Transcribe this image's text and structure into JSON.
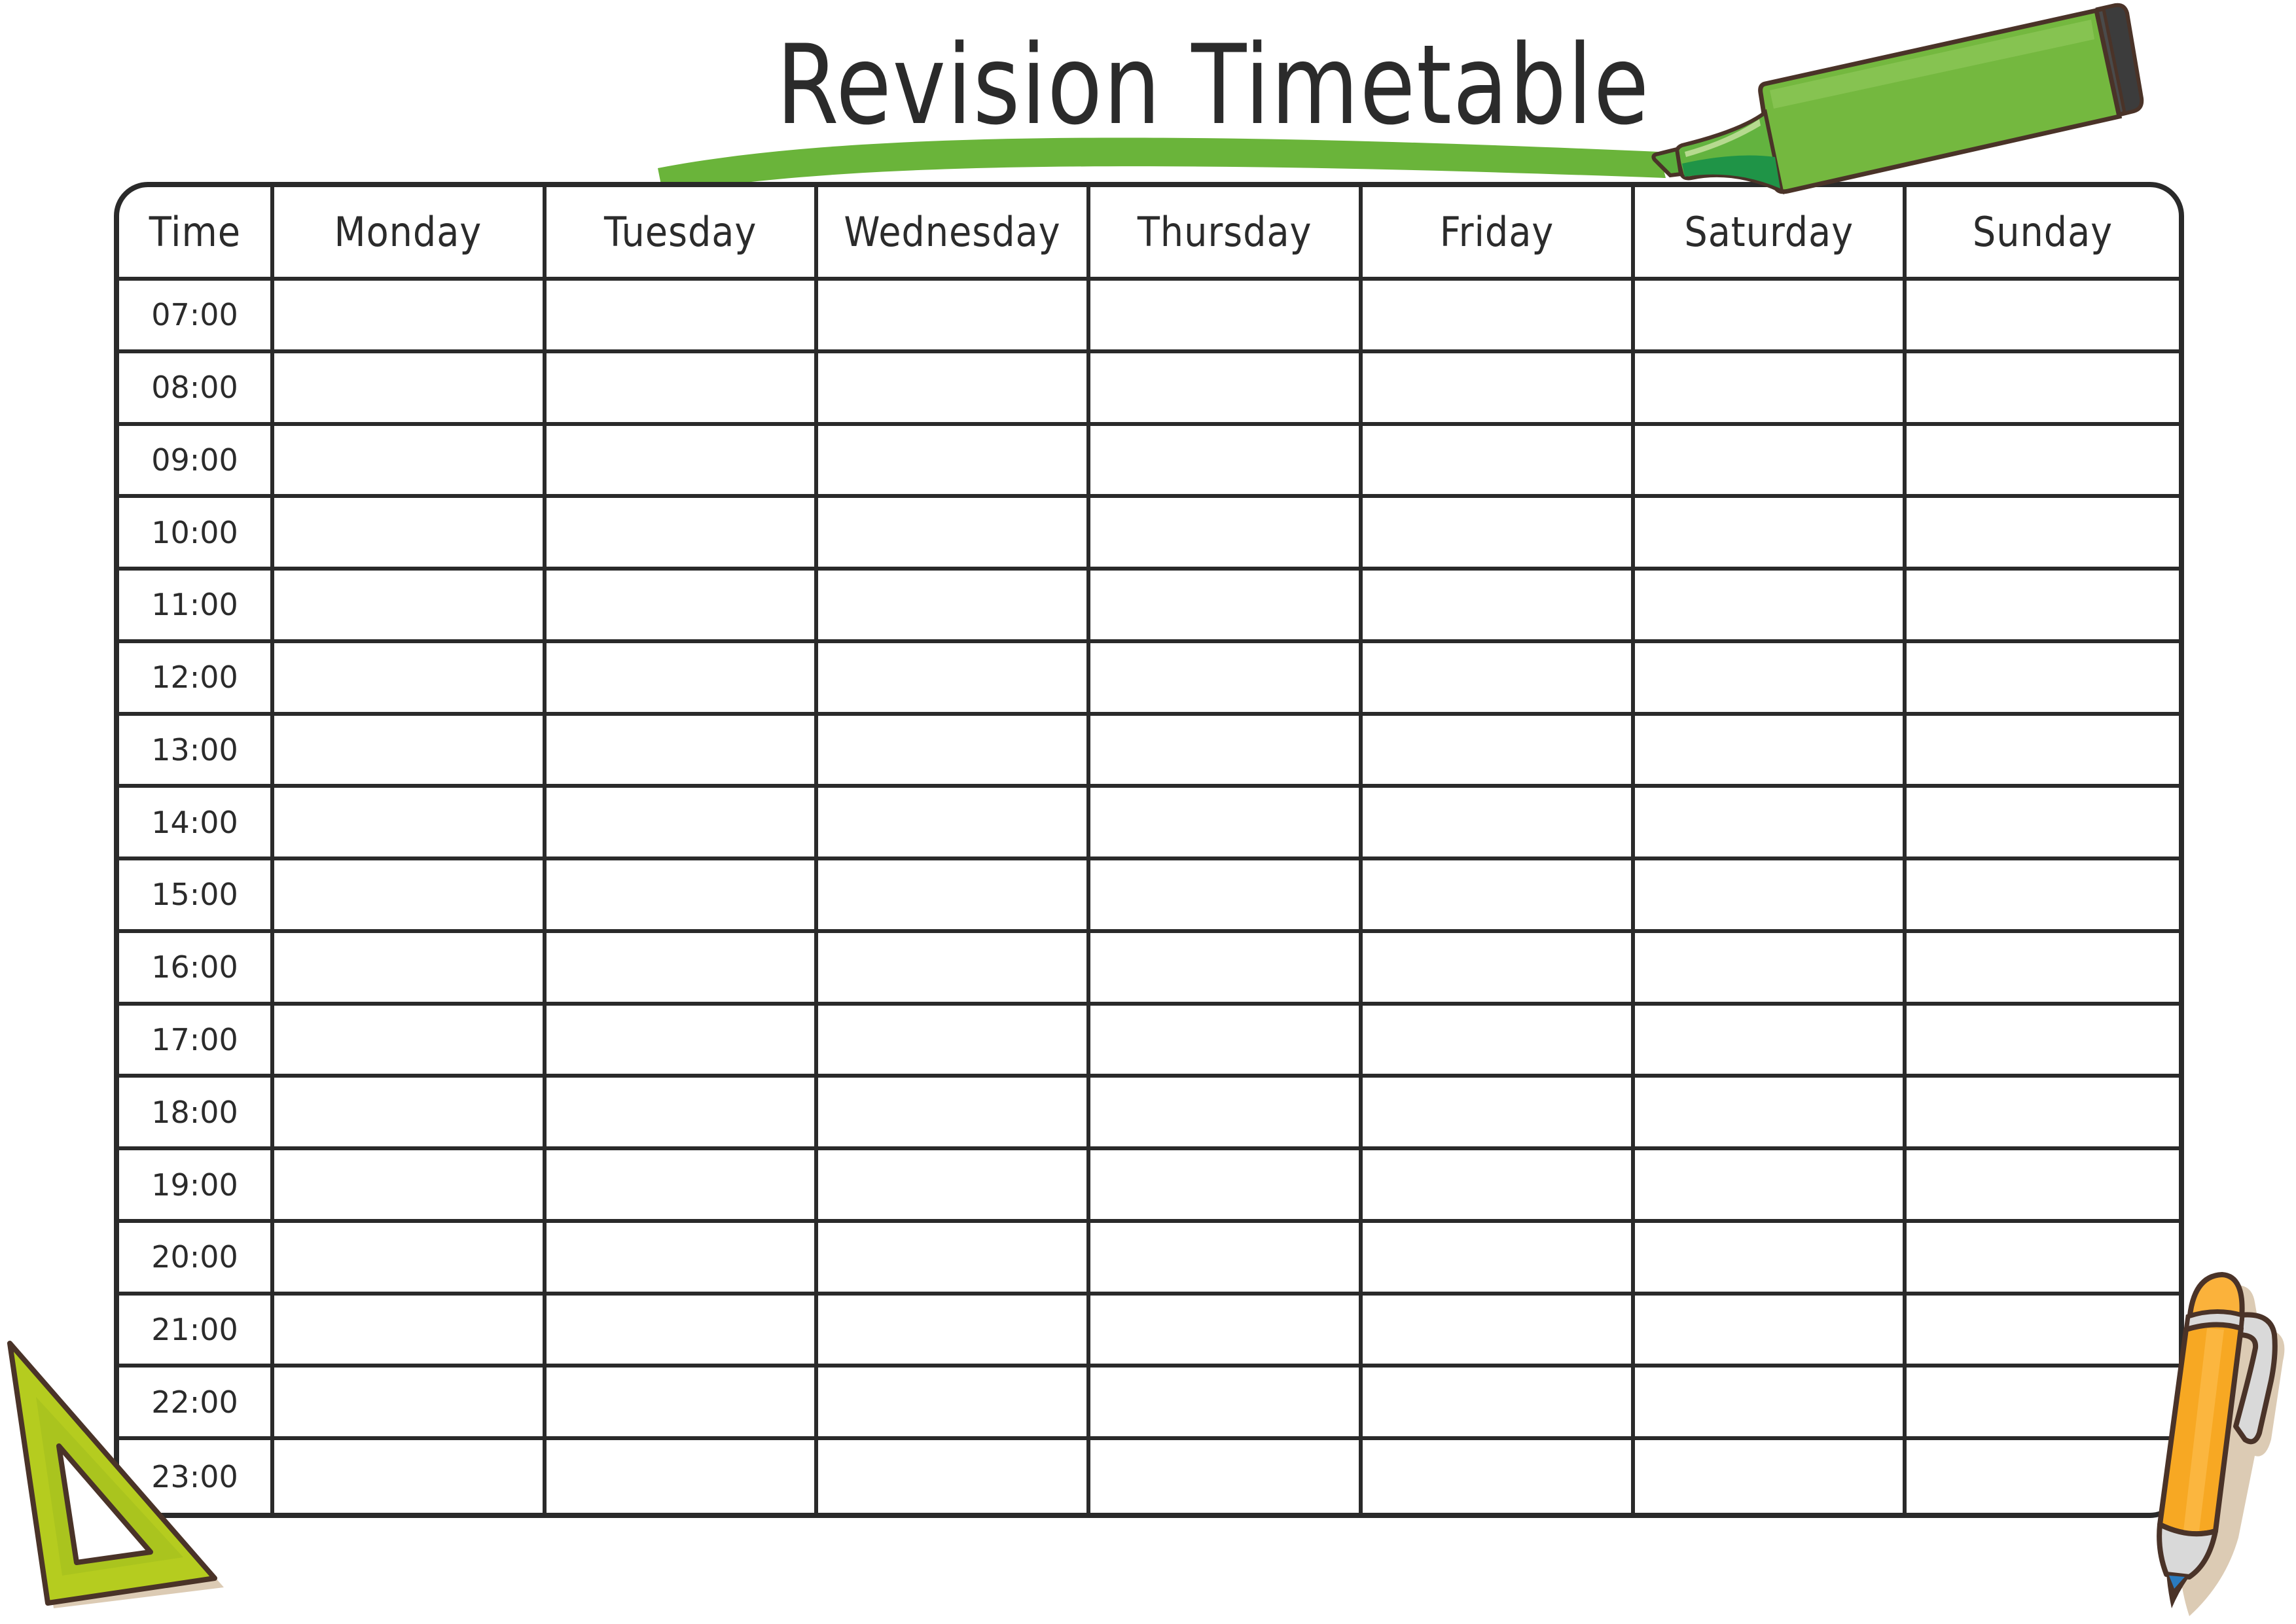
{
  "title": "Revision Timetable",
  "table": {
    "corner_header": "Time",
    "days": [
      "Monday",
      "Tuesday",
      "Wednesday",
      "Thursday",
      "Friday",
      "Saturday",
      "Sunday"
    ],
    "times": [
      "07:00",
      "08:00",
      "09:00",
      "10:00",
      "11:00",
      "12:00",
      "13:00",
      "14:00",
      "15:00",
      "16:00",
      "17:00",
      "18:00",
      "19:00",
      "20:00",
      "21:00",
      "22:00",
      "23:00"
    ],
    "entries": {}
  },
  "decorations": {
    "highlighter_icon": "green-highlighter-marker",
    "highlight_stroke": "green-highlight-underline",
    "set_square_icon": "triangle-set-square",
    "pen_icon": "orange-ballpoint-pen"
  },
  "colors": {
    "ink": "#2a2a2a",
    "highlight_green": "#6ab43a",
    "marker_body": "#74b83f",
    "marker_dark_band": "#1f9447",
    "marker_cap": "#3c3c3c",
    "set_square": "#b5cc1f",
    "pen_body": "#f7a823",
    "pen_stripe": "#fbb63f",
    "pen_clip": "#d9d9d9",
    "pen_tip": "#2a7bbf",
    "outline": "#4a3328",
    "shadow": "#dccbb4"
  }
}
